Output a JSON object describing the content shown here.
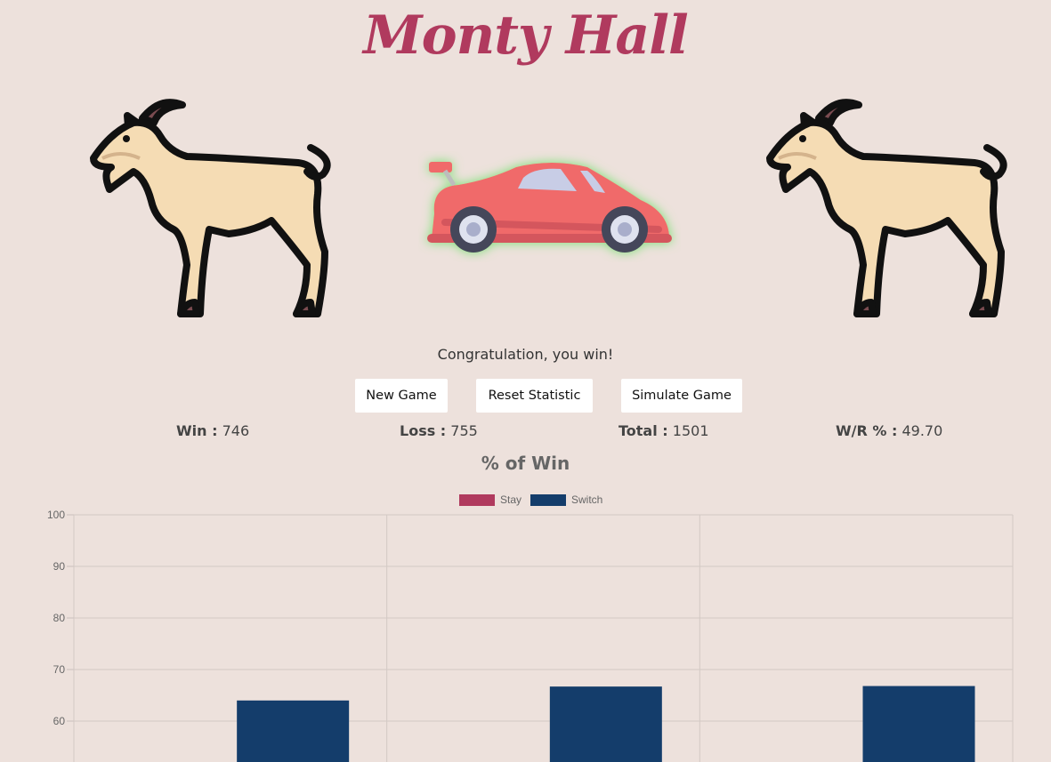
{
  "page": {
    "title": "Monty Hall",
    "message": "Congratulation, you win!"
  },
  "doors": [
    {
      "content": "goat",
      "icon": "goat-icon"
    },
    {
      "content": "car",
      "icon": "car-icon",
      "highlighted": true
    },
    {
      "content": "goat",
      "icon": "goat-icon"
    }
  ],
  "buttons": {
    "new_game": "New Game",
    "reset_statistic": "Reset Statistic",
    "simulate_game": "Simulate Game"
  },
  "stats": {
    "win_label": "Win :",
    "win_value": "746",
    "loss_label": "Loss :",
    "loss_value": "755",
    "total_label": "Total :",
    "total_value": "1501",
    "wr_label": "W/R % :",
    "wr_value": "49.70"
  },
  "chart_heading": "% of Win",
  "colors": {
    "background": "#ede1dc",
    "title": "#b03a5e",
    "stay": "#b03a5e",
    "switch": "#143d6b"
  },
  "chart_data": {
    "type": "bar",
    "categories": [
      "",
      "",
      ""
    ],
    "series": [
      {
        "name": "Stay",
        "color": "#b03a5e",
        "values": [
          null,
          null,
          null
        ]
      },
      {
        "name": "Switch",
        "color": "#143d6b",
        "values": [
          64,
          66.7,
          66.8
        ]
      }
    ],
    "ylim": [
      50,
      100
    ],
    "yticks": [
      100,
      90,
      80,
      70,
      60
    ],
    "grid": true,
    "legend": "top-center"
  }
}
